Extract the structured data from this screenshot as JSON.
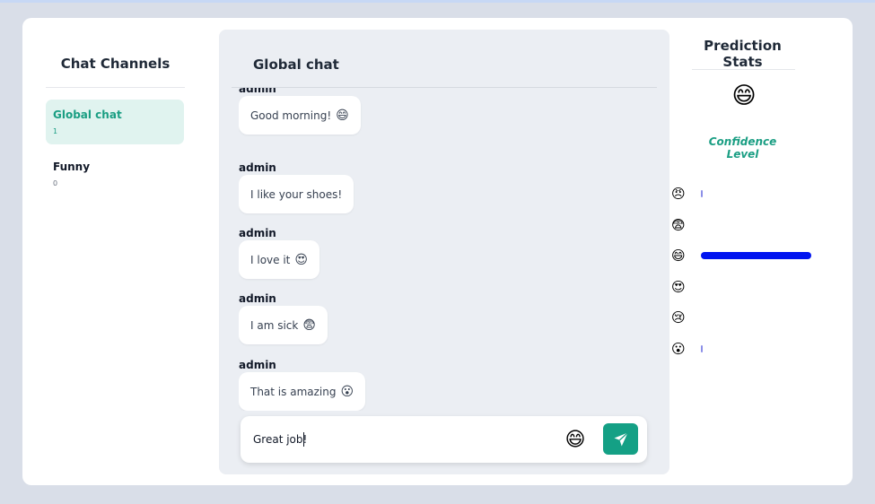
{
  "left": {
    "title": "Chat Channels",
    "channels": [
      {
        "name": "Global chat",
        "count": "1"
      },
      {
        "name": "Funny",
        "count": "0"
      }
    ]
  },
  "chat": {
    "title": "Global chat",
    "messages": [
      {
        "author": "admin",
        "text": "Good morning!",
        "emoji": "😄"
      },
      {
        "author": "admin",
        "text": "I like your shoes!",
        "emoji": ""
      },
      {
        "author": "admin",
        "text": "I love it",
        "emoji": "😍"
      },
      {
        "author": "admin",
        "text": "I am sick",
        "emoji": "😨"
      },
      {
        "author": "admin",
        "text": "That is amazing",
        "emoji": "😮"
      }
    ],
    "input": {
      "value": "Great job!"
    },
    "input_emoji": "😄",
    "send_icon": "paper-plane-icon"
  },
  "stats": {
    "title": "Prediction Stats",
    "predicted_emoji": "😄",
    "confidence_label": "Confidence Level",
    "rows": [
      {
        "emoji": "😠",
        "confidence": 0.01
      },
      {
        "emoji": "😨",
        "confidence": 0
      },
      {
        "emoji": "😄",
        "confidence": 0.98
      },
      {
        "emoji": "😍",
        "confidence": 0
      },
      {
        "emoji": "😢",
        "confidence": 0
      },
      {
        "emoji": "😮",
        "confidence": 0.01
      }
    ]
  },
  "colors": {
    "accent": "#14a085",
    "bar": "#0014f0",
    "panel": "#ebeef3",
    "background": "#d9dee8"
  }
}
